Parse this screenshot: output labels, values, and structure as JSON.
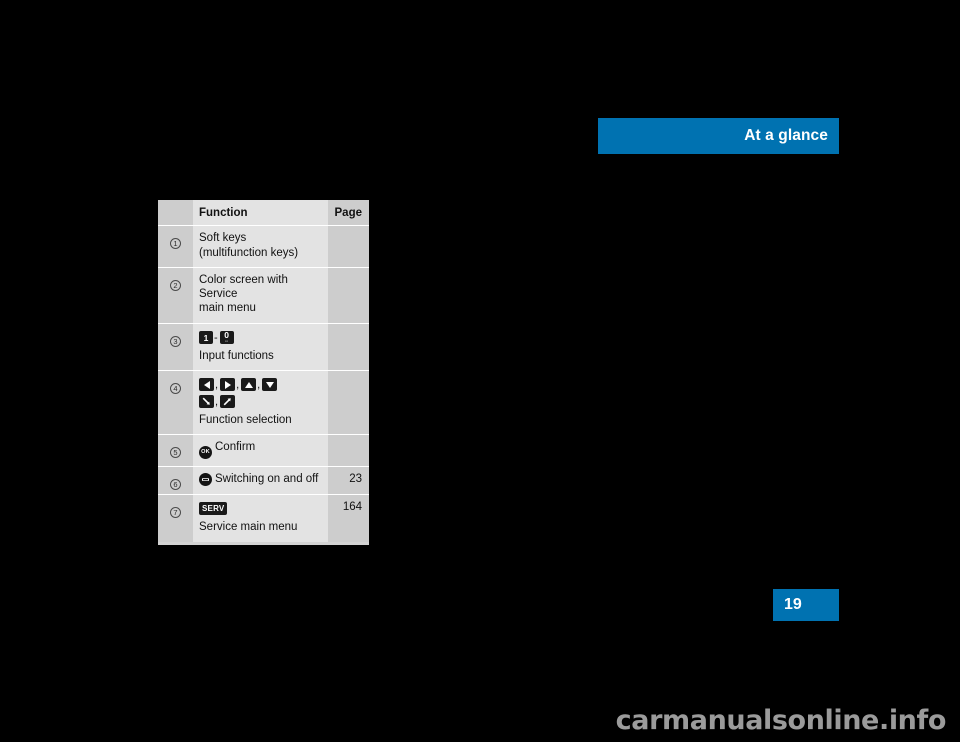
{
  "header": {
    "title": "At a glance",
    "accent_color": "#0072b1"
  },
  "page_number": {
    "value": "19"
  },
  "watermark": {
    "text": "carmanualsonline.info"
  },
  "table": {
    "columns": {
      "index": "",
      "function": "Function",
      "page": "Page"
    },
    "rows": [
      {
        "index": "1",
        "lines": [
          "Soft keys",
          "(multifunction keys)"
        ],
        "keys": [],
        "caption": "",
        "page": ""
      },
      {
        "index": "2",
        "lines": [
          "Color screen with Service",
          "main menu"
        ],
        "keys": [],
        "caption": "",
        "page": ""
      },
      {
        "index": "3",
        "lines": [],
        "keys": [
          "key-1",
          "dash",
          "key-0"
        ],
        "key_labels": {
          "key_1": "1",
          "key_0": "0",
          "key_0_sub": "␣",
          "dash": "-"
        },
        "caption": "Input functions",
        "page": ""
      },
      {
        "index": "4",
        "lines": [],
        "keys": [
          "arrow-left",
          "arrow-right",
          "arrow-up",
          "arrow-down",
          "arrow-diag-down",
          "arrow-diag-up"
        ],
        "caption": "Function selection",
        "page": ""
      },
      {
        "index": "5",
        "icon": "ok-button",
        "icon_label": "OK",
        "inline_text": "Confirm",
        "page": ""
      },
      {
        "index": "6",
        "icon": "power-button",
        "icon_label": "⏻",
        "inline_text": "Switching on and off",
        "page": "23"
      },
      {
        "index": "7",
        "badge": "SERV",
        "caption": "Service main menu",
        "page": "164"
      }
    ]
  }
}
